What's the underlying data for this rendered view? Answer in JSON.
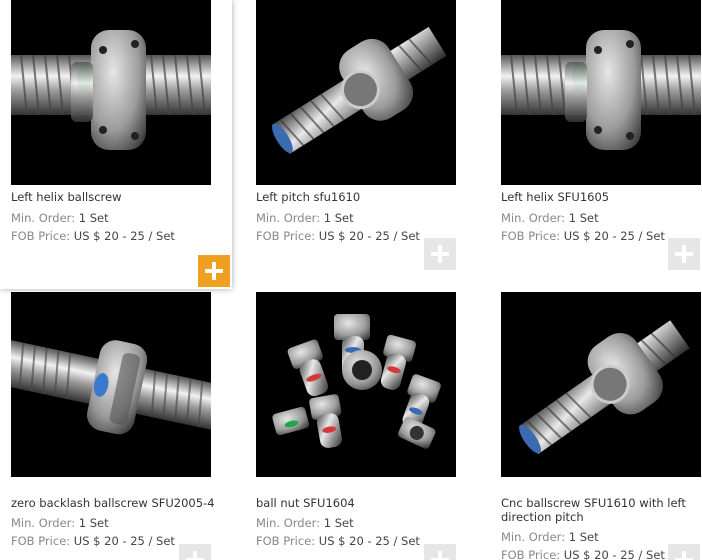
{
  "labels": {
    "min_order": "Min. Order:",
    "fob_price": "FOB Price:"
  },
  "products": [
    {
      "title": "Left helix ballscrew",
      "min_order": "1 Set",
      "fob_price": "US $ 20 - 25 / Set",
      "image_icon": "ballscrew-flange-nut-image",
      "add_icon": "plus-icon"
    },
    {
      "title": "Left pitch sfu1610",
      "min_order": "1 Set",
      "fob_price": "US $ 20 - 25 / Set",
      "image_icon": "ballscrew-diagonal-image",
      "add_icon": "plus-icon"
    },
    {
      "title": "Left helix SFU1605",
      "min_order": "1 Set",
      "fob_price": "US $ 20 - 25 / Set",
      "image_icon": "ballscrew-flange-nut-image",
      "add_icon": "plus-icon"
    },
    {
      "title": "zero backlash ballscrew SFU2005-4",
      "min_order": "1 Set",
      "fob_price": "US $ 20 - 25 / Set",
      "image_icon": "ballscrew-horizontal-image",
      "add_icon": "plus-icon"
    },
    {
      "title": "ball nut SFU1604",
      "min_order": "1 Set",
      "fob_price": "US $ 20 - 25 / Set",
      "image_icon": "ball-nuts-group-image",
      "add_icon": "plus-icon"
    },
    {
      "title": "Cnc ballscrew SFU1610 with left direction pitch",
      "min_order": "1 Set",
      "fob_price": "US $ 20 - 25 / Set",
      "image_icon": "ballscrew-diagonal-image",
      "add_icon": "plus-icon"
    }
  ],
  "colors": {
    "add_active": "#f0a020",
    "add_inactive": "#e6e6e6",
    "photo_bg": "#000000"
  }
}
